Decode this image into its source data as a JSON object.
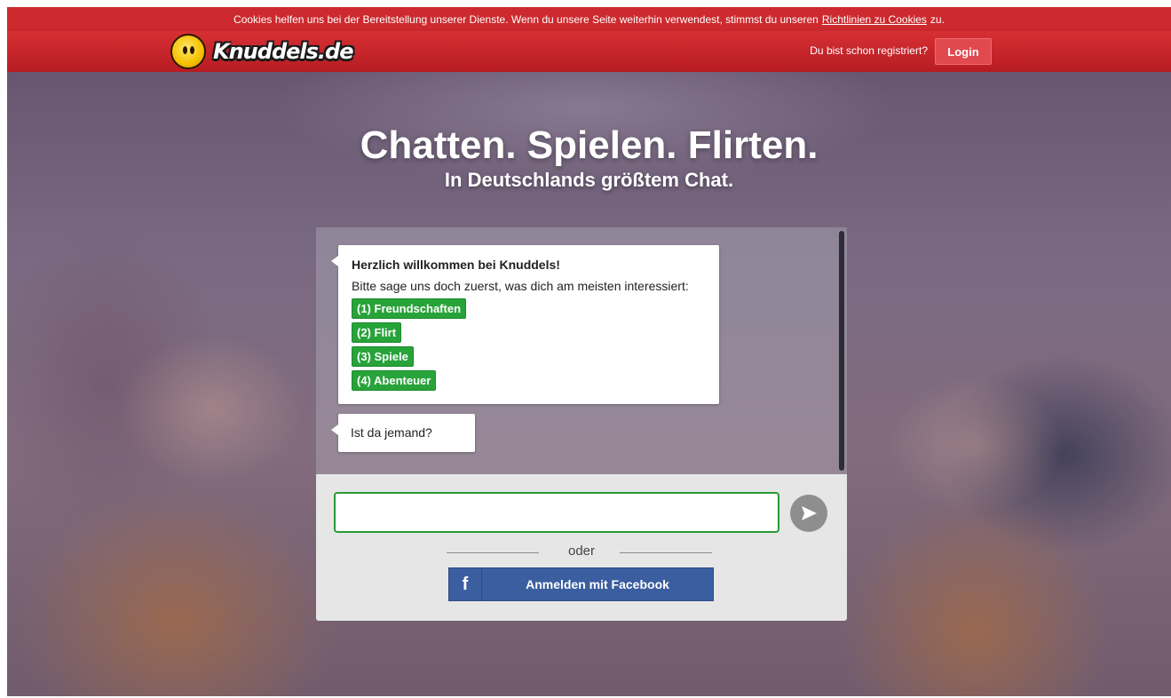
{
  "cookie_bar": {
    "text": "Cookies helfen uns bei der Bereitstellung unserer Dienste. Wenn du unsere Seite weiterhin verwendest, stimmst du unseren",
    "link": "Richtlinien zu Cookies",
    "tail": "zu."
  },
  "header": {
    "logo_text": "Knuddels.de",
    "registered_text": "Du bist schon registriert?",
    "login_label": "Login"
  },
  "hero": {
    "headline": "Chatten. Spielen. Flirten.",
    "subline": "In Deutschlands größtem Chat."
  },
  "chat": {
    "welcome": {
      "title": "Herzlich willkommen bei Knuddels!",
      "text": "Bitte sage uns doch zuerst, was dich am meisten interessiert:",
      "options": [
        "(1) Freundschaften",
        "(2) Flirt",
        "(3) Spiele",
        "(4) Abenteuer"
      ]
    },
    "question": "Ist da jemand?",
    "input_value": "",
    "or_text": "oder",
    "facebook_label": "Anmelden mit Facebook",
    "facebook_icon": "f"
  },
  "colors": {
    "brand_red": "#cc2a2e",
    "option_green": "#28a33a",
    "facebook_blue": "#3b5ea0"
  },
  "icons": {
    "send": "send-arrow-icon",
    "facebook": "facebook-icon",
    "logo": "knuddel-face-icon"
  }
}
